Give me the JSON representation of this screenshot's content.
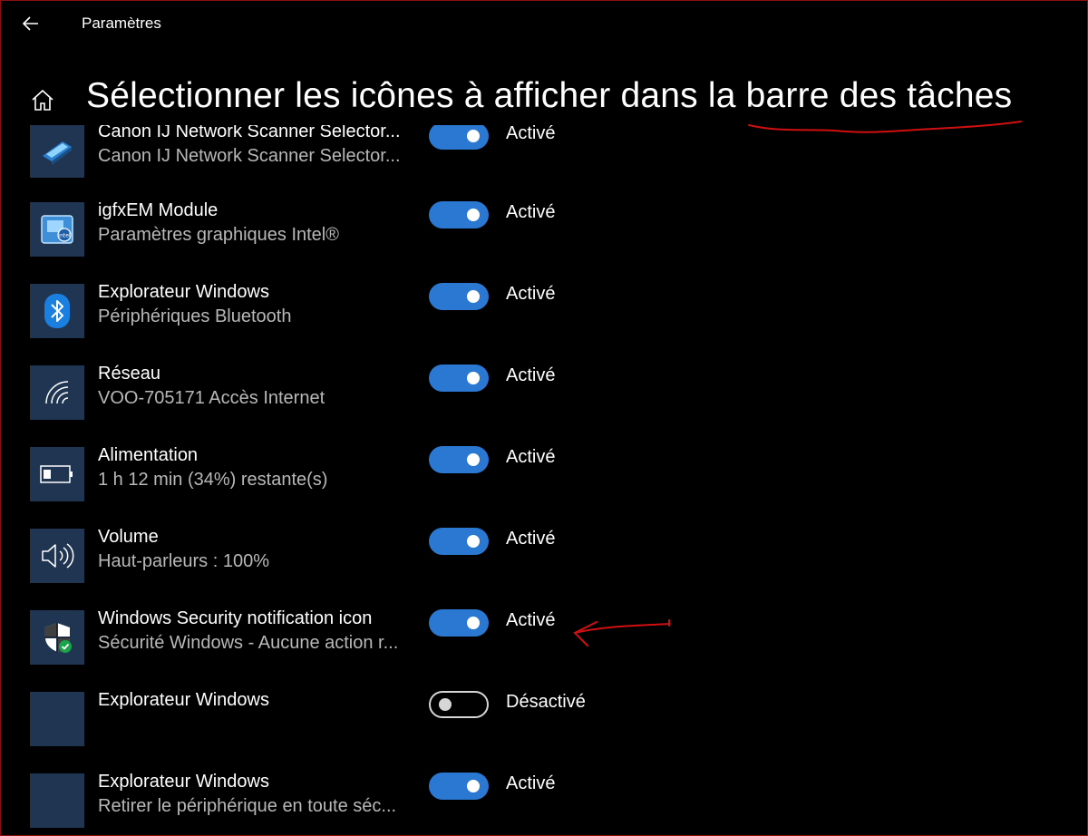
{
  "window": {
    "title": "Paramètres"
  },
  "page": {
    "title": "Sélectionner les icônes à afficher dans la barre des tâches"
  },
  "items": [
    {
      "icon": "scanner-icon",
      "name": "Canon IJ Network Scanner Selector...",
      "sub": "Canon IJ Network Scanner Selector...",
      "state": "Activé",
      "on": true
    },
    {
      "icon": "intel-graphics-icon",
      "name": "igfxEM Module",
      "sub": "Paramètres graphiques Intel®",
      "state": "Activé",
      "on": true
    },
    {
      "icon": "bluetooth-icon",
      "name": "Explorateur Windows",
      "sub": "Périphériques Bluetooth",
      "state": "Activé",
      "on": true
    },
    {
      "icon": "wifi-icon",
      "name": "Réseau",
      "sub": "VOO-705171 Accès Internet",
      "state": "Activé",
      "on": true
    },
    {
      "icon": "battery-icon",
      "name": "Alimentation",
      "sub": "1 h 12 min (34%) restante(s)",
      "state": "Activé",
      "on": true
    },
    {
      "icon": "speaker-icon",
      "name": "Volume",
      "sub": "Haut-parleurs : 100%",
      "state": "Activé",
      "on": true
    },
    {
      "icon": "windows-security-icon",
      "name": "Windows Security notification icon",
      "sub": "Sécurité Windows - Aucune action r...",
      "state": "Activé",
      "on": true
    },
    {
      "icon": "blank-app-icon",
      "name": "Explorateur Windows",
      "sub": "",
      "state": "Désactivé",
      "on": false
    },
    {
      "icon": "blank-app-icon",
      "name": "Explorateur Windows",
      "sub": "Retirer le périphérique en toute séc...",
      "state": "Activé",
      "on": true
    }
  ],
  "colors": {
    "accent": "#2b78d3",
    "tile": "#1f3552",
    "annotation": "#d01010"
  }
}
